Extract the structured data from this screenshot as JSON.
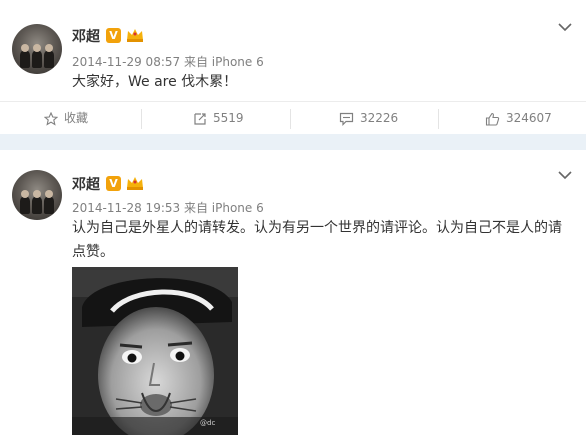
{
  "posts": [
    {
      "author": "邓超",
      "verified_badge": "V",
      "timestamp": "2014-11-29 08:57",
      "source": "来自 iPhone 6",
      "text": "大家好，We are 伐木累！",
      "actions": {
        "favorite_label": "收藏",
        "repost_count": "5519",
        "comment_count": "32226",
        "like_count": "324607"
      }
    },
    {
      "author": "邓超",
      "verified_badge": "V",
      "timestamp": "2014-11-28 19:53",
      "source": "来自 iPhone 6",
      "text_line1": "认为自己是外星人的请转发。认为有另一个世界的请评论。认为自己不是人的请",
      "text_line2": "点赞。",
      "watermark": "@dc"
    }
  ],
  "colors": {
    "page_background": "#eaf1f7",
    "card_background": "#ffffff",
    "secondary_text": "#808080",
    "verified_badge": "#f2a20b"
  },
  "icons": [
    "chevron-down-icon",
    "star-icon",
    "repost-icon",
    "comment-icon",
    "thumbs-up-icon",
    "crown-badge-icon"
  ]
}
